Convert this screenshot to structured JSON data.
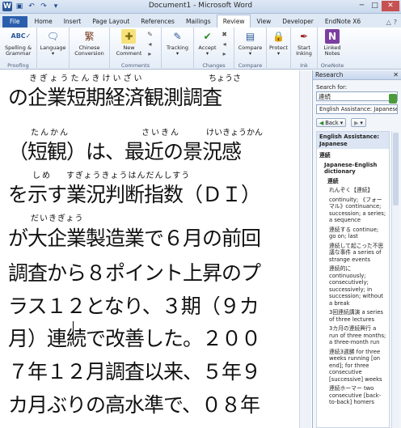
{
  "window": {
    "title": "Document1 - Microsoft Word",
    "app_letter": "W"
  },
  "qat": {
    "save_icon": "save-icon",
    "undo_icon": "undo-icon",
    "redo_icon": "redo-icon",
    "customize_icon": "customize-icon"
  },
  "tabs": [
    "File",
    "Home",
    "Insert",
    "Page Layout",
    "References",
    "Mailings",
    "Review",
    "View",
    "Developer",
    "EndNote X6"
  ],
  "active_tab": "Review",
  "ribbon": {
    "proofing": {
      "label": "Proofing",
      "spelling": "Spelling &",
      "grammar": "Grammar"
    },
    "language": {
      "label": "Language"
    },
    "chinese": {
      "label": "Chinese",
      "label2": "Conversion"
    },
    "comments": {
      "label": "Comments",
      "new": "New",
      "comment": "Comment"
    },
    "tracking": {
      "label": "Tracking"
    },
    "changes": {
      "label": "Changes",
      "accept": "Accept"
    },
    "compare": {
      "label": "Compare"
    },
    "protect": {
      "label": "Protect"
    },
    "ink": {
      "label": "Ink",
      "start": "Start",
      "inking": "Inking"
    },
    "onenote": {
      "label": "OneNote",
      "linked": "Linked",
      "notes": "Notes"
    }
  },
  "document": {
    "lines": [
      "の企業短期経済観測調査",
      "（短観）は、最近の景況感",
      "を示す業況判断指数（ＤＩ）",
      "が大企業製造業で６月の前回",
      "調査から８ポイント上昇のプ",
      "ラス１２となり、３期（９カ",
      "月）連続で改善した。２００",
      "７年１２月調査以来、５年９",
      "カ月ぶりの高水準で、０８年"
    ],
    "ruby": [
      {
        "text": "きぎょうたんきけいざい",
        "line": 0
      },
      {
        "text": "ちょうさ",
        "line": 0
      },
      {
        "text": "たんかん",
        "line": 1
      },
      {
        "text": "さいきん",
        "line": 1
      },
      {
        "text": "けいきょうかん",
        "line": 1
      },
      {
        "text": "しめ",
        "line": 2
      },
      {
        "text": "すぎょうきょうはんだんしすう",
        "line": 2
      },
      {
        "text": "だいきぎょう",
        "line": 3
      }
    ]
  },
  "research": {
    "title": "Research",
    "search_for": "Search for:",
    "query": "連続",
    "source": "English Assistance: Japanese",
    "back": "Back",
    "results": [
      {
        "text": "English Assistance: Japanese",
        "bold": true
      },
      {
        "text": "連続",
        "bold": true
      },
      {
        "text": "Japanese-English dictionary",
        "bold": true
      },
      {
        "text": "連続",
        "bold": true
      },
      {
        "text": "れんぞく【連続】",
        "bold": false
      },
      {
        "text": "continuity; 《フォーマル》continuance; succession; a series; a sequence",
        "bold": false
      },
      {
        "text": "連続する continue; go on; last",
        "bold": false
      },
      {
        "text": "連続して起こった不思議な事件 a series of strange events",
        "bold": false
      },
      {
        "text": "連続的に continuously; consecutively; successively; in succession; without a break",
        "bold": false
      },
      {
        "text": "3回連続講演 a series of three lectures",
        "bold": false
      },
      {
        "text": "3カ月の連続興行 a run of three months; a three-month run",
        "bold": false
      },
      {
        "text": "連続3週勝 for three weeks running [on end]; for three consecutive [successive] weeks",
        "bold": false
      },
      {
        "text": "連続ホーマー two consecutive [back-to-back] homers",
        "bold": false
      }
    ]
  }
}
